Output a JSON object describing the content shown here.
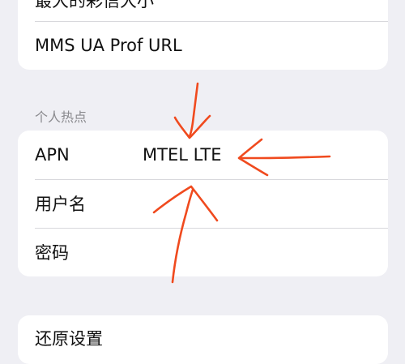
{
  "mms_group": {
    "partial_row_label": "最大的彩信大小",
    "profile_url_label": "MMS UA Prof URL"
  },
  "hotspot": {
    "section_title": "个人热点",
    "rows": [
      {
        "label": "APN",
        "value": "MTEL LTE"
      },
      {
        "label": "用户名",
        "value": ""
      },
      {
        "label": "密码",
        "value": ""
      }
    ]
  },
  "reset": {
    "label": "还原设置"
  },
  "colors": {
    "background": "#efeff4",
    "card": "#ffffff",
    "separator": "#d8d8dc",
    "section_header": "#8a8a8e",
    "link": "#2f73e0",
    "annotation": "#f04a1e"
  }
}
